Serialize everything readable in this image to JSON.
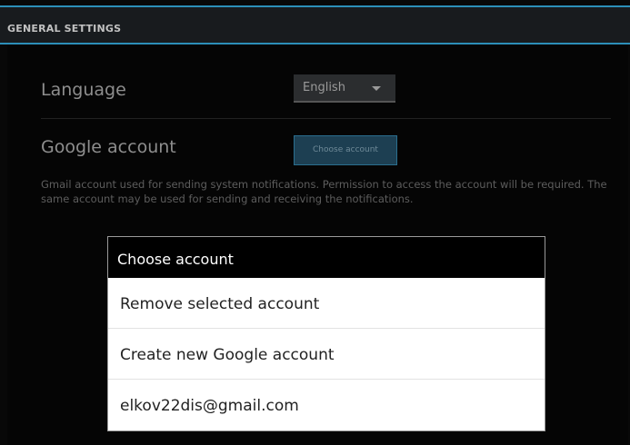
{
  "header": {
    "title": "GENERAL SETTINGS"
  },
  "settings": {
    "language": {
      "label": "Language",
      "value": "English"
    },
    "google_account": {
      "label": "Google account",
      "button_label": "Choose account",
      "description": "Gmail account used for sending system notifications. Permission to access the account will be required. The same account may be used for sending and receiving the notifications."
    }
  },
  "dialog": {
    "title": "Choose account",
    "options": [
      "Remove selected account",
      "Create new Google account",
      "elkov22dis@gmail.com"
    ]
  },
  "icons": {
    "language_dropdown": "chevron-down-icon"
  },
  "colors": {
    "accent": "#2c8fb9",
    "background": "#080808",
    "dialog_bg": "#ffffff"
  }
}
